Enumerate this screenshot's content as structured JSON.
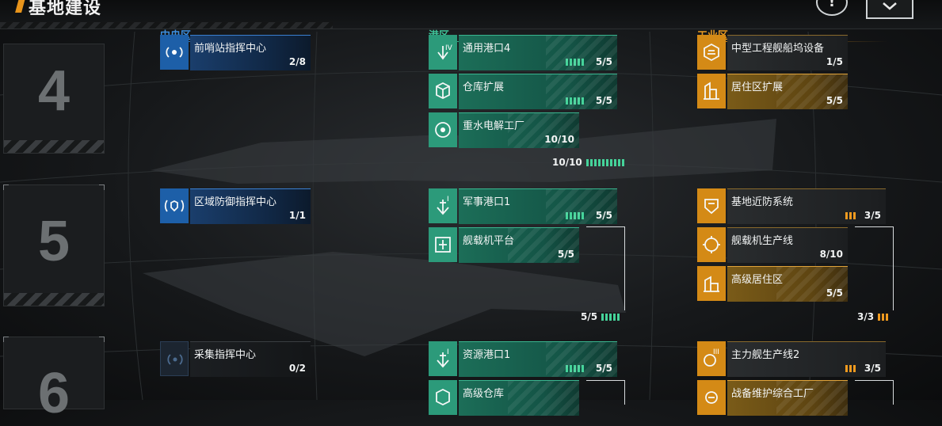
{
  "header": {
    "title": "基地建设",
    "help_label": "!"
  },
  "columns": [
    {
      "id": "central",
      "label": "中央区",
      "color": "#3d8fe0"
    },
    {
      "id": "port",
      "label": "港区",
      "color": "#3fc59a"
    },
    {
      "id": "industrial",
      "label": "工业区",
      "color": "#e89a22"
    }
  ],
  "tiers": [
    {
      "label": "4"
    },
    {
      "label": "5"
    },
    {
      "label": "6"
    }
  ],
  "cards": {
    "t4_central": {
      "name": "前哨站指挥中心",
      "progress": "2/8"
    },
    "t4_port_1": {
      "name": "通用港口4",
      "progress": "5/5"
    },
    "t4_port_2": {
      "name": "仓库扩展",
      "progress": "5/5"
    },
    "t4_port_3": {
      "name": "重水电解工厂",
      "progress": "10/10"
    },
    "t4_port_total": "10/10",
    "t4_ind_1": {
      "name": "中型工程舰船坞设备",
      "progress": "1/5"
    },
    "t4_ind_2": {
      "name": "居住区扩展",
      "progress": "5/5"
    },
    "t5_central": {
      "name": "区域防御指挥中心",
      "progress": "1/1"
    },
    "t5_port_1": {
      "name": "军事港口1",
      "progress": "5/5"
    },
    "t5_port_2": {
      "name": "舰载机平台",
      "progress": "5/5"
    },
    "t5_port_total": "5/5",
    "t5_ind_1": {
      "name": "基地近防系统",
      "progress": "3/5"
    },
    "t5_ind_2": {
      "name": "舰载机生产线",
      "progress": "8/10"
    },
    "t5_ind_3": {
      "name": "高级居住区",
      "progress": "5/5"
    },
    "t5_ind_total": "3/3",
    "t6_central": {
      "name": "采集指挥中心",
      "progress": "0/2"
    },
    "t6_port_1": {
      "name": "资源港口1",
      "progress": "5/5"
    },
    "t6_port_2": {
      "name": "高级仓库",
      "progress": ""
    },
    "t6_ind_1": {
      "name": "主力舰生产线2",
      "progress": "3/5"
    },
    "t6_ind_2": {
      "name": "战备维护综合工厂",
      "progress": ""
    }
  },
  "icons": {
    "t4_central": "broadcast-icon",
    "t4_port_1": "anchor-iv-icon",
    "t4_port_2": "warehouse-cube-icon",
    "t4_port_3": "electrolysis-icon",
    "t4_ind_1": "shipyard-hex-icon",
    "t4_ind_2": "residence-icon",
    "t5_central": "shield-signal-icon",
    "t5_port_1": "anchor-i-icon",
    "t5_port_2": "aircraft-platform-icon",
    "t5_ind_1": "defense-turret-icon",
    "t5_ind_2": "gear-production-icon",
    "t5_ind_3": "buildings-icon",
    "t6_central": "signal-icon",
    "t6_port_1": "anchor-resource-icon",
    "t6_port_2": "warehouse-icon",
    "t6_ind_1": "capital-ship-iii-icon",
    "t6_ind_2": "maintenance-icon"
  },
  "colors": {
    "green": "#2c9a7a",
    "orange": "#d48a16",
    "blue": "#1d5fa8"
  }
}
